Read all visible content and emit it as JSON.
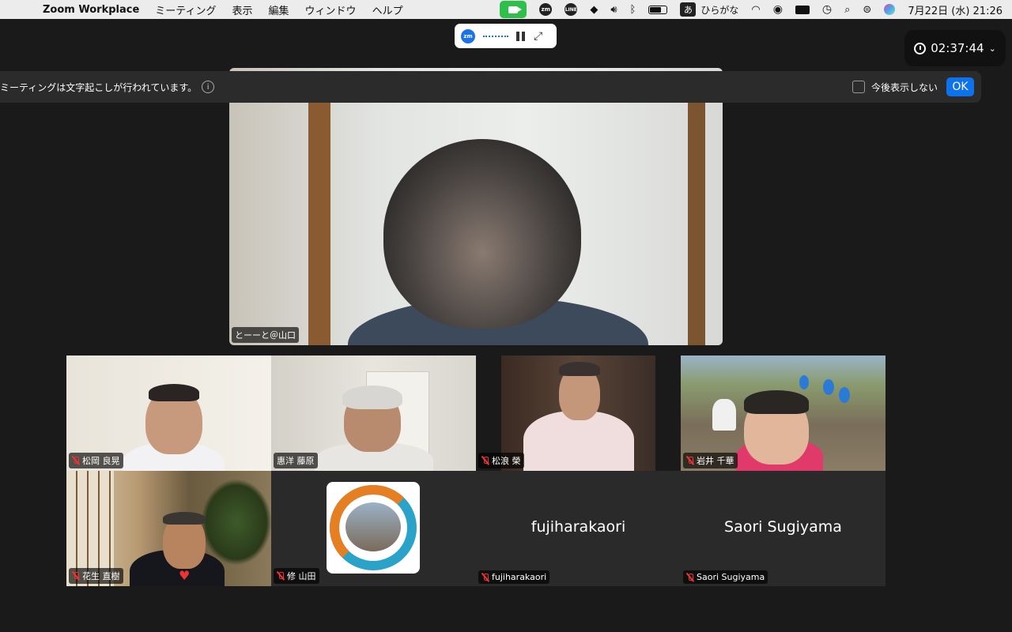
{
  "menubar": {
    "app_name": "Zoom Workplace",
    "menus": [
      "ミーティング",
      "表示",
      "編集",
      "ウィンドウ",
      "ヘルプ"
    ],
    "ime_char": "あ",
    "ime_label": "ひらがな",
    "datetime": "7月22日 (水)  21:26",
    "zoom_glyph": "zm",
    "line_glyph": "LINE"
  },
  "recording": {
    "zm_glyph": "zm"
  },
  "timer": {
    "elapsed": "02:37:44"
  },
  "banner": {
    "message": "ミーティングは文字起こしが行われています。",
    "dont_show_label": "今後表示しない",
    "ok_label": "OK"
  },
  "speaker": {
    "name": "とーーと＠山口"
  },
  "gallery": [
    {
      "name": "松岡 良晃",
      "muted": true
    },
    {
      "name": "惠洋 藤原",
      "muted": false
    },
    {
      "name": "松浪 榮",
      "muted": true
    },
    {
      "name": "岩井 千華",
      "muted": true
    },
    {
      "name": "花生 直樹",
      "muted": true
    },
    {
      "name": "修 山田",
      "muted": true
    },
    {
      "name": "fujiharakaori",
      "muted": true,
      "video_off": true
    },
    {
      "name": "Saori Sugiyama",
      "muted": true,
      "video_off": true
    }
  ],
  "colors": {
    "accent": "#0e72ed",
    "zoom_green": "#2fbf4a",
    "muted_red": "#e33333",
    "background": "#1a1a1a"
  }
}
